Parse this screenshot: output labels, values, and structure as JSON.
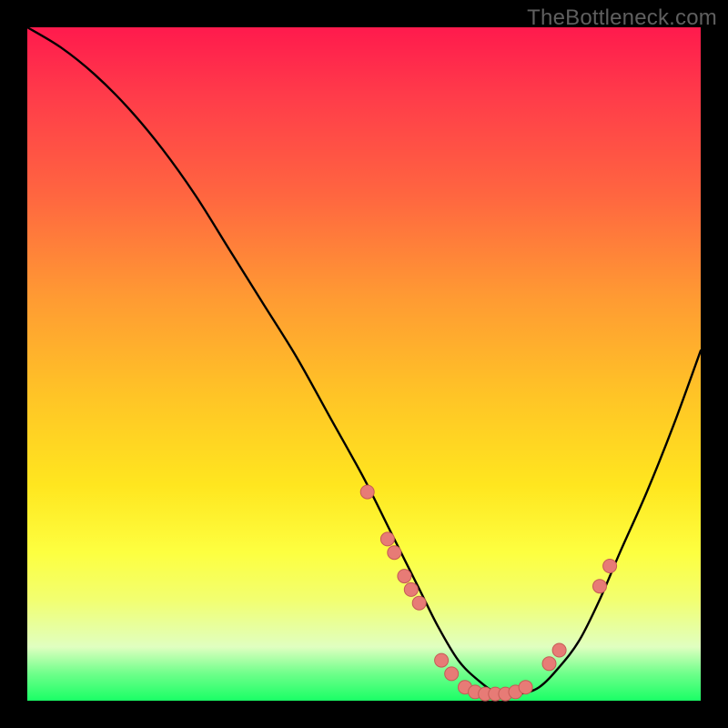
{
  "watermark": "TheBottleneck.com",
  "colors": {
    "background": "#000000",
    "curve": "#000000",
    "dot_fill": "#e77b76",
    "dot_stroke": "#c55a55"
  },
  "chart_data": {
    "type": "line",
    "title": "",
    "xlabel": "",
    "ylabel": "",
    "xlim": [
      0,
      100
    ],
    "ylim": [
      0,
      100
    ],
    "note": "Axis values are inferred percentages of plot area (0=left/bottom, 100=right/top). The curve is a V-shaped bottleneck profile dropping from top-left to a flat minimum around x≈60–75 then rising toward the right edge.",
    "series": [
      {
        "name": "bottleneck-curve",
        "x": [
          0,
          5,
          10,
          15,
          20,
          25,
          30,
          35,
          40,
          45,
          50,
          54,
          58,
          61,
          64,
          67,
          70,
          73,
          76,
          79,
          82,
          85,
          88,
          92,
          96,
          100
        ],
        "y": [
          100,
          97,
          93,
          88,
          82,
          75,
          67,
          59,
          51,
          42,
          33,
          25,
          17,
          11,
          6,
          3,
          1,
          1,
          2,
          5,
          9,
          15,
          22,
          31,
          41,
          52
        ]
      }
    ],
    "dots": {
      "name": "marker-points",
      "x": [
        50.5,
        53.5,
        54.5,
        56.0,
        57.0,
        58.2,
        61.5,
        63.0,
        65.0,
        66.5,
        68.0,
        69.5,
        71.0,
        72.5,
        74.0,
        77.5,
        79.0,
        85.0,
        86.5
      ],
      "y": [
        31.0,
        24.0,
        22.0,
        18.5,
        16.5,
        14.5,
        6.0,
        4.0,
        2.0,
        1.3,
        1.0,
        1.0,
        1.0,
        1.3,
        2.0,
        5.5,
        7.5,
        17.0,
        20.0
      ]
    }
  }
}
